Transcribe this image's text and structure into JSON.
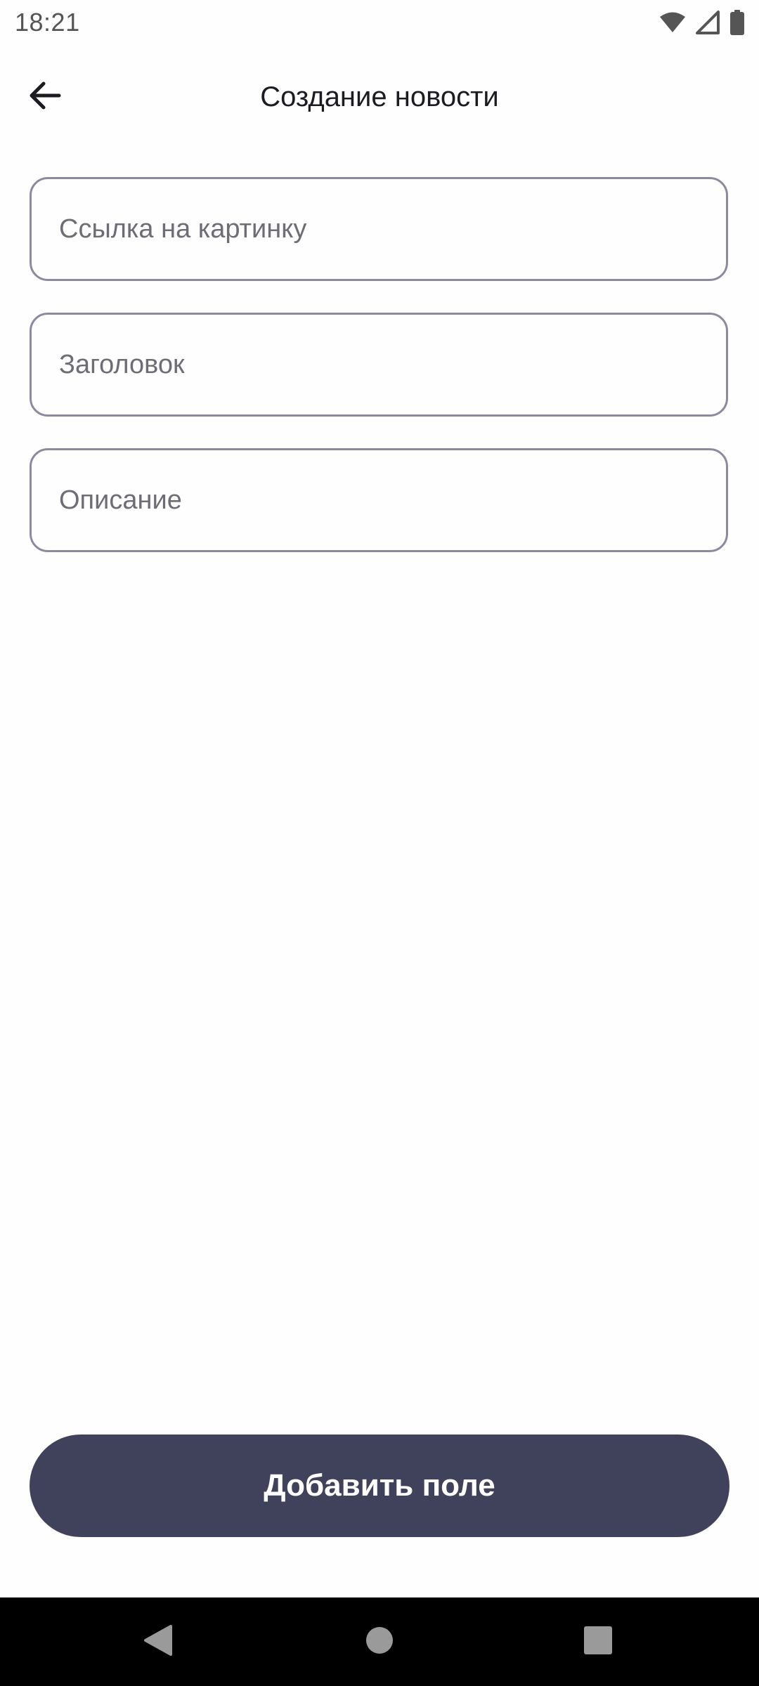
{
  "status_bar": {
    "time": "18:21",
    "icons": [
      "wifi-icon",
      "cellular-signal-icon",
      "battery-icon"
    ]
  },
  "app_bar": {
    "back_icon": "arrow-back-icon",
    "title": "Создание новости"
  },
  "form": {
    "image_link": {
      "value": "",
      "placeholder": "Ссылка на картинку"
    },
    "title": {
      "value": "",
      "placeholder": "Заголовок"
    },
    "description": {
      "value": "",
      "placeholder": "Описание"
    }
  },
  "actions": {
    "add_field_label": "Добавить поле"
  },
  "nav_bar": {
    "items": [
      "nav-back-icon",
      "nav-home-icon",
      "nav-recents-icon"
    ]
  },
  "colors": {
    "primary_button": "#40415a",
    "field_border": "#8c8b9d",
    "placeholder": "#6e6d75",
    "title_text": "#1b1b21",
    "background": "#fefeff"
  }
}
